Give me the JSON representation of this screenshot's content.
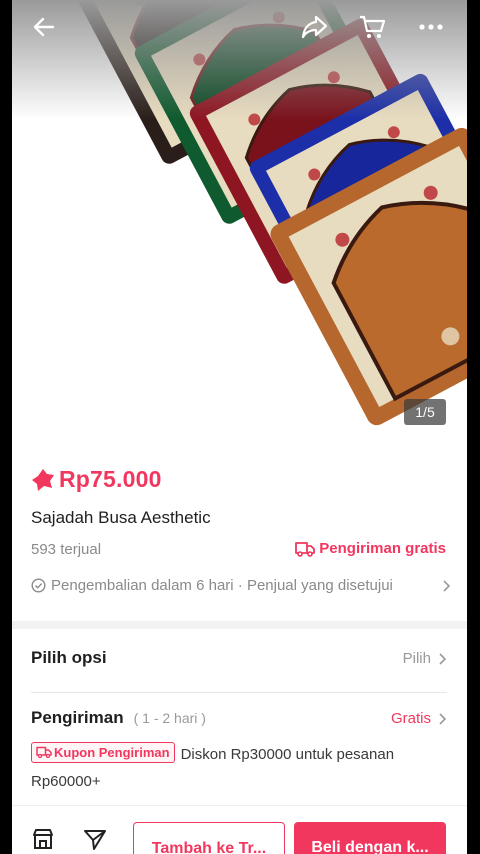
{
  "product": {
    "image_counter": "1/5",
    "price": "Rp75.000",
    "title": "Sajadah Busa Aesthetic",
    "sold": "593 terjual",
    "free_shipping": "Pengiriman gratis",
    "returns": "Pengembalian dalam 6 hari · Penjual yang disetujui"
  },
  "options": {
    "label": "Pilih opsi",
    "action": "Pilih"
  },
  "shipping": {
    "label": "Pengiriman",
    "days": "( 1 - 2 hari )",
    "value": "Gratis",
    "coupon_badge": "Kupon Pengiriman",
    "coupon_text": "Diskon Rp30000 untuk pesanan Rp60000+"
  },
  "bottom_bar": {
    "add_to_cart": "Tambah ke Tr...",
    "buy_now": "Beli dengan k..."
  },
  "icons": [
    "back-arrow-icon",
    "share-icon",
    "cart-icon",
    "more-icon",
    "price-tag-icon",
    "truck-icon",
    "check-circle-icon",
    "chevron-right-icon",
    "store-icon",
    "chat-icon"
  ],
  "colors": {
    "accent": "#f2375f",
    "rug_colors": [
      "#2a1e1a",
      "#0f5a2e",
      "#8e1622",
      "#1c2fa8",
      "#b5672e"
    ]
  }
}
